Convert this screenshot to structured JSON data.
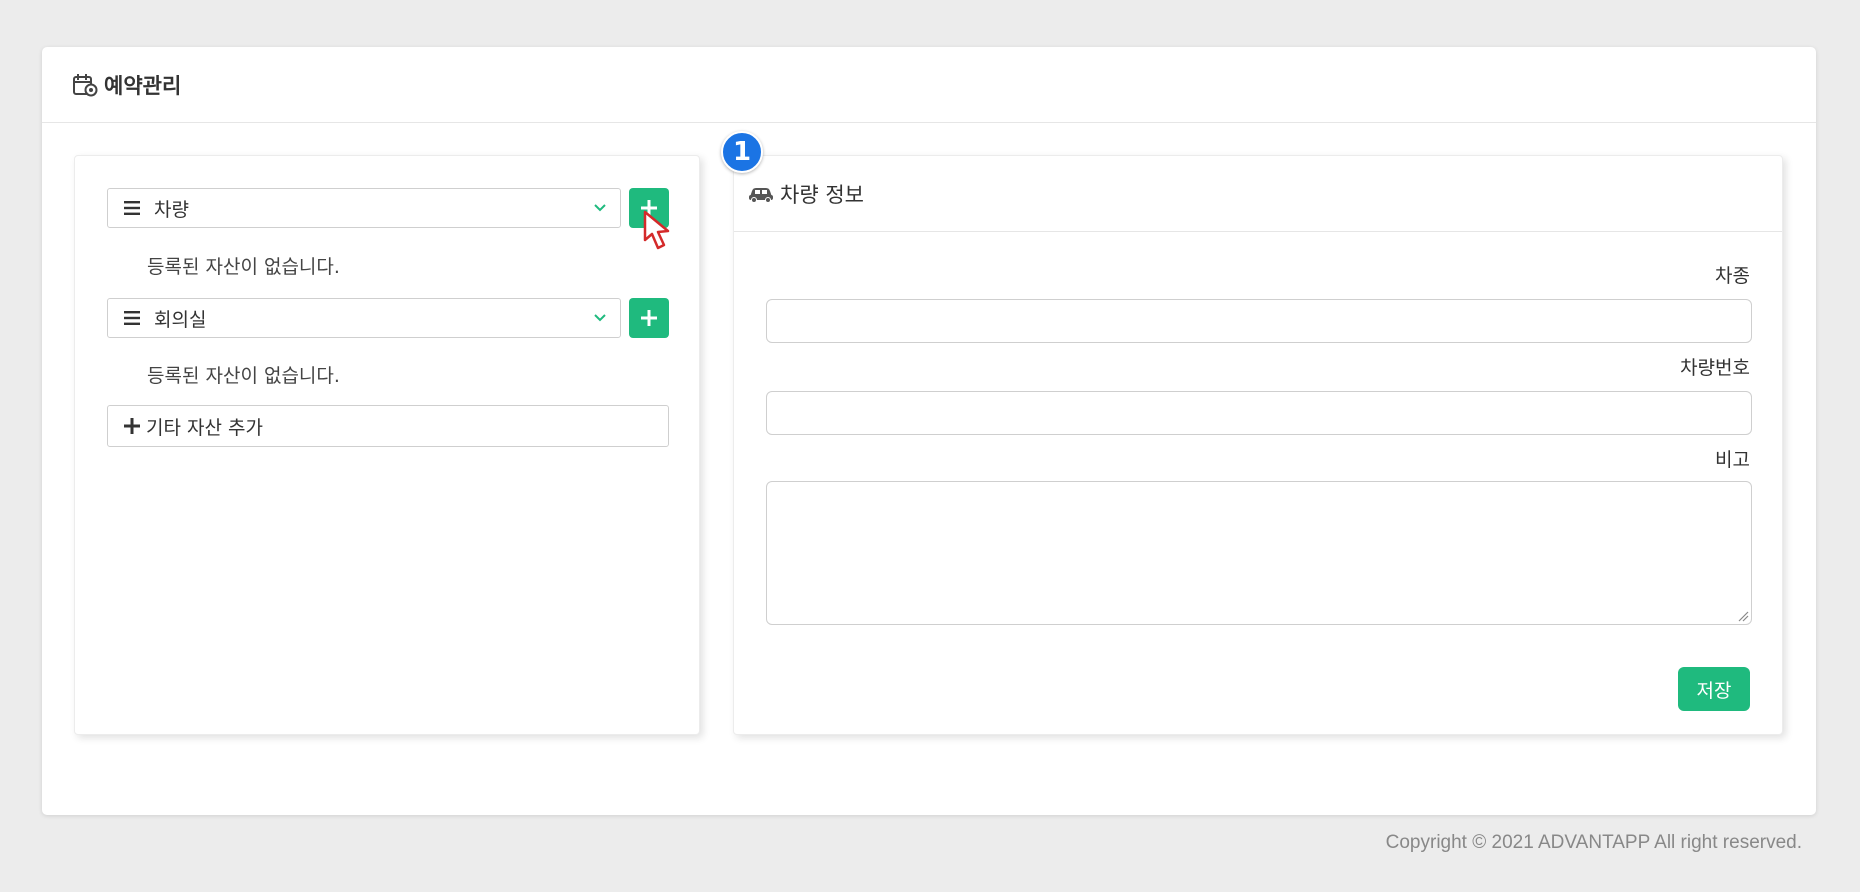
{
  "header": {
    "title": "예약관리",
    "icon": "calendar-gear-icon"
  },
  "left_panel": {
    "assets": [
      {
        "label": "차량",
        "empty_message": "등록된 자산이 없습니다."
      },
      {
        "label": "회의실",
        "empty_message": "등록된 자산이 없습니다."
      }
    ],
    "add_other_asset_label": "기타 자산 추가"
  },
  "step_badge": "1",
  "right_panel": {
    "title": "차량 정보",
    "icon": "car-icon",
    "fields": {
      "car_type_label": "차종",
      "car_type_value": "",
      "plate_label": "차량번호",
      "plate_value": "",
      "note_label": "비고",
      "note_value": ""
    },
    "save_label": "저장"
  },
  "footer": {
    "copyright": "Copyright © 2021 ADVANTAPP All right reserved."
  },
  "colors": {
    "accent": "#1fba7e",
    "badge": "#1b74e4",
    "background": "#ececec"
  }
}
